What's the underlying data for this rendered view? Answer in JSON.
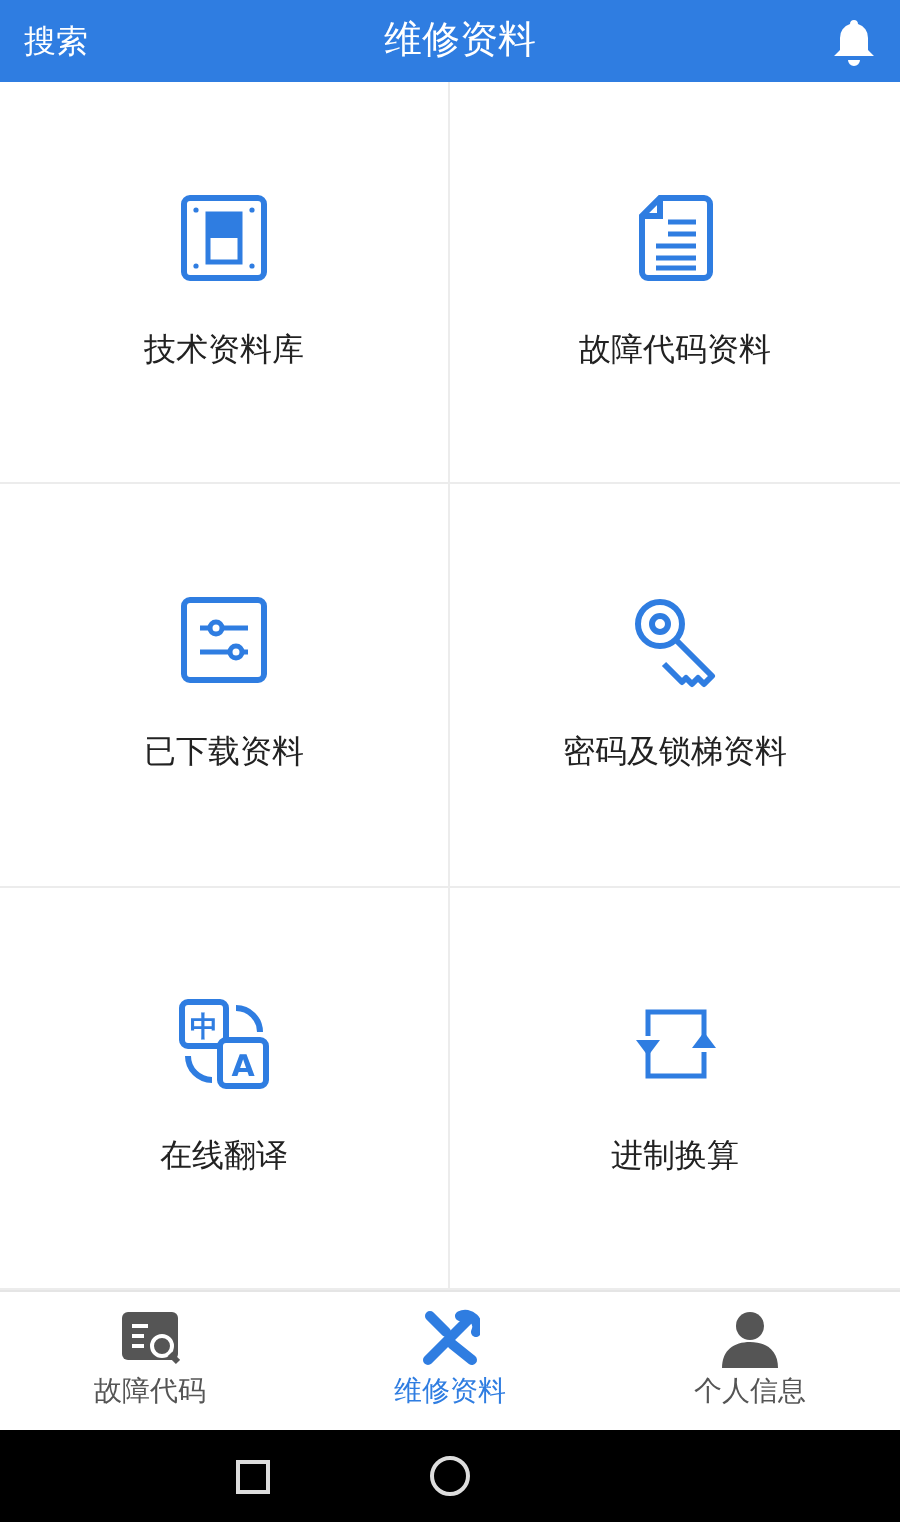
{
  "header": {
    "search": "搜索",
    "title": "维修资料"
  },
  "tiles": [
    {
      "kind": "library",
      "label": "技术资料库"
    },
    {
      "kind": "document",
      "label": "故障代码资料"
    },
    {
      "kind": "sliders",
      "label": "已下载资料"
    },
    {
      "kind": "key",
      "label": "密码及锁梯资料"
    },
    {
      "kind": "translate",
      "label": "在线翻译",
      "glyphs": [
        "中",
        "A"
      ]
    },
    {
      "kind": "convert",
      "label": "进制换算"
    }
  ],
  "tabs": [
    {
      "kind": "code",
      "label": "故障代码",
      "selected": false
    },
    {
      "kind": "tools",
      "label": "维修资料",
      "selected": true
    },
    {
      "kind": "person",
      "label": "个人信息",
      "selected": false
    }
  ]
}
